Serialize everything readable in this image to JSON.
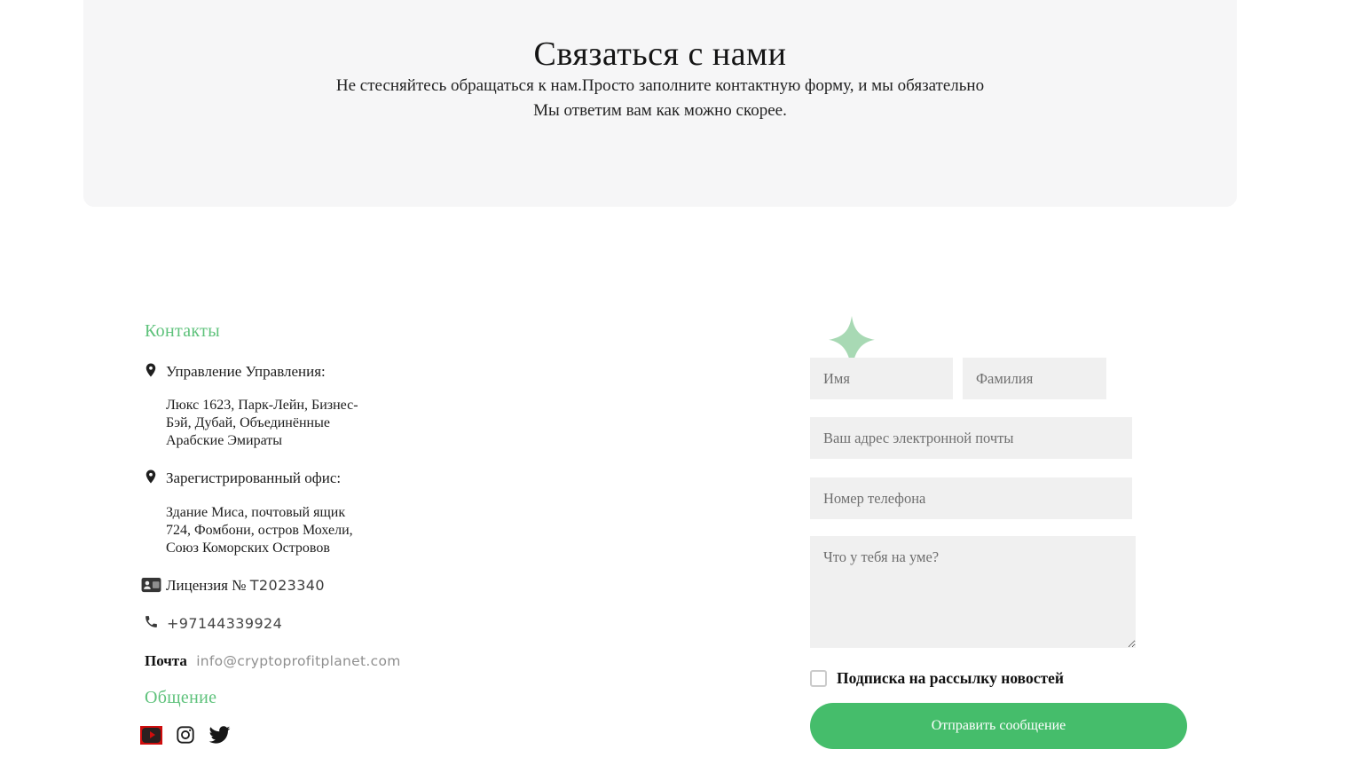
{
  "hero": {
    "title": "Связаться с нами",
    "subtitle_line1": "Не стесняйтесь обращаться к нам.Просто заполните контактную форму, и мы обязательно",
    "subtitle_line2": "Мы ответим вам как можно скорее.",
    "bg_color": "#f6f6f7"
  },
  "contacts": {
    "heading": "Контакты",
    "items": [
      {
        "icon": "location-pin-icon",
        "title": "Управление Управления:",
        "address": "Люкс 1623, Парк-Лейн, Бизнес-\nБэй, Дубай, Объединённые\nАрабские Эмираты"
      },
      {
        "icon": "location-pin-icon",
        "title": "Зарегистрированный офис:",
        "address": "Здание Миса, почтовый ящик\n724, Фомбони, остров Мохели,\nСоюз Коморских Островов"
      }
    ],
    "license_label": "Лицензия №",
    "license_value": "T2023340",
    "phone": "+97144339924",
    "mail_label": "Почта",
    "email": "info@cryptoprofitplanet.com",
    "social_heading": "Общение",
    "social_icons": [
      "youtube-icon",
      "instagram-icon",
      "twitter-icon"
    ]
  },
  "form": {
    "first_name_placeholder": "Имя",
    "last_name_placeholder": "Фамилия",
    "email_placeholder": "Ваш адрес электронной почты",
    "phone_placeholder": "Номер телефона",
    "message_placeholder": "Что у тебя на уме?",
    "newsletter_label": "Подписка на рассылку новостей",
    "submit_label": "Отправить сообщение",
    "accent_green": "#45bd6b",
    "heading_green": "#5ec27b",
    "sparkle_green": "#a8d9b4",
    "input_bg": "#f0f0f0"
  }
}
